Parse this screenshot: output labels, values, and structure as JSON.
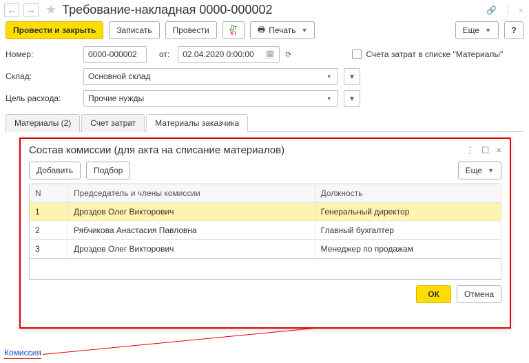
{
  "title": "Требование-накладная 0000-000002",
  "toolbar": {
    "post_close": "Провести и закрыть",
    "write": "Записать",
    "post": "Провести",
    "print": "Печать",
    "more": "Еще"
  },
  "form": {
    "number_label": "Номер:",
    "number_value": "0000-000002",
    "from_label": "от:",
    "date_value": "02.04.2020  0:00:00",
    "checkbox_label": "Счета затрат в списке \"Материалы\"",
    "warehouse_label": "Склад:",
    "warehouse_value": "Основной склад",
    "purpose_label": "Цель расхода:",
    "purpose_value": "Прочие нужды"
  },
  "tabs": {
    "t1": "Материалы (2)",
    "t2": "Счет затрат",
    "t3": "Материалы заказчика"
  },
  "dialog": {
    "title": "Состав комиссии (для акта на списание материалов)",
    "add": "Добавить",
    "pick": "Подбор",
    "more": "Еще",
    "col_n": "N",
    "col_member": "Председатель и члены комиссии",
    "col_role": "Должность",
    "rows": [
      {
        "n": "1",
        "member": "Дроздов Олег Викторович",
        "role": "Генеральный директор"
      },
      {
        "n": "2",
        "member": "Рябчикова Анастасия Павловна",
        "role": "Главный бухгалтер"
      },
      {
        "n": "3",
        "member": "Дроздов Олег Викторович",
        "role": "Менеджер по продажам"
      }
    ],
    "ok": "ОК",
    "cancel": "Отмена"
  },
  "link": "Комиссия"
}
